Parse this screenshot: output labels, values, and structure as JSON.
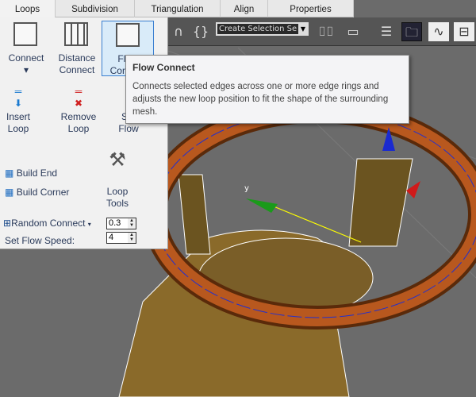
{
  "tabs": [
    "Loops",
    "Subdivision",
    "Triangulation",
    "Align",
    "Properties"
  ],
  "active_tab": "Loops",
  "panel": {
    "connect": "Connect",
    "distance_connect": [
      "Distance",
      "Connect"
    ],
    "flow_connect": [
      "Flow",
      "Connect"
    ],
    "insert_loop": [
      "Insert",
      "Loop"
    ],
    "remove_loop": [
      "Remove",
      "Loop"
    ],
    "set_flow": [
      "Set",
      "Flow"
    ],
    "build_end": "Build End",
    "build_corner": "Build Corner",
    "loop_tools": [
      "Loop",
      "Tools"
    ],
    "random_connect": "Random Connect",
    "random_connect_value": "0.3",
    "set_flow_speed": "Set Flow Speed:",
    "set_flow_speed_value": "4"
  },
  "tooltip": {
    "title": "Flow Connect",
    "body": "Connects selected edges across one or more edge rings and adjusts the new loop position to fit the shape of the surrounding mesh."
  },
  "toolbar": {
    "selection_set": "Create Selection Se"
  },
  "viewport": {
    "axis_label": "y"
  },
  "colors": {
    "viewport_bg": "#6b6b6b",
    "mesh": "#8a6a2a",
    "ring": "#a44a1a",
    "highlight": "#3a7fd0"
  }
}
